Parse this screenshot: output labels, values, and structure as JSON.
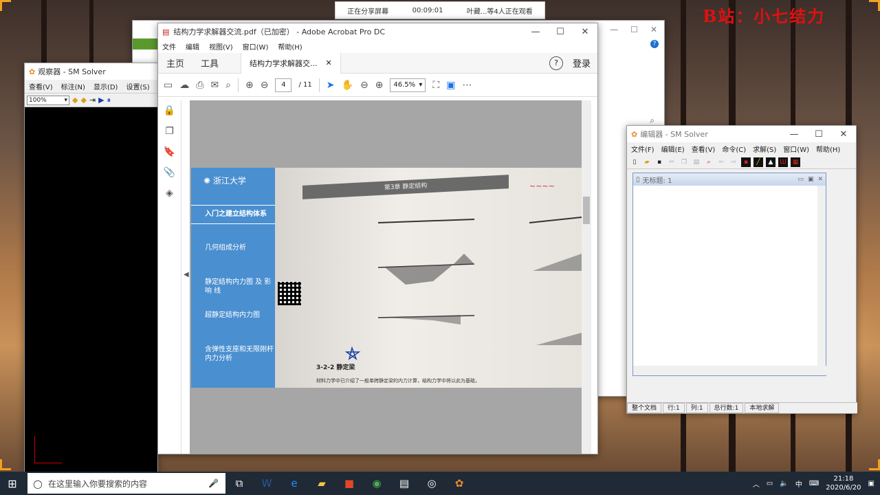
{
  "screen_share": {
    "status": "正在分享屏幕",
    "timer": "00:09:01",
    "viewers": "叶藏...等4人正在观看"
  },
  "watermark": "B站：小七结力",
  "viewer_window": {
    "title": "观察器 - SM Solver",
    "menu": [
      "查看(V)",
      "标注(N)",
      "显示(D)",
      "设置(S)"
    ],
    "zoom": "100%"
  },
  "acrobat": {
    "title": "结构力学求解器交流.pdf（已加密） - Adobe Acrobat Pro DC",
    "menu": [
      "文件",
      "编辑",
      "视图(V)",
      "窗口(W)",
      "帮助(H)"
    ],
    "nav_home": "主页",
    "nav_tools": "工具",
    "doc_tab": "结构力学求解器交...",
    "login": "登录",
    "page_current": "4",
    "page_total": "/ 11",
    "zoom": "46.5%",
    "slide": {
      "items": [
        "入门之建立结构体系",
        "几何组成分析",
        "静定结构内力图 及 影 响 线",
        "超静定结构内力图",
        "含弹性支座和无限刚杆内力分析"
      ],
      "book_heading": "第3章 静定结构",
      "section": "3-2-2 静定梁",
      "caption": "材料力学中已介绍了一般单跨静定梁的内力计算，结构力学中将以此为基础，"
    }
  },
  "editor_window": {
    "title": "编辑器 - SM Solver",
    "menu": [
      "文件(F)",
      "编辑(E)",
      "查看(V)",
      "命令(C)",
      "求解(S)",
      "窗口(W)",
      "帮助(H)"
    ],
    "doc_title": "无标题: 1",
    "status": [
      "整个文档",
      "行:1",
      "列:1",
      "总行数:1",
      "本地求解"
    ]
  },
  "taskbar": {
    "search_placeholder": "在这里输入你要搜索的内容",
    "time": "21:18",
    "date": "2020/6/20",
    "ime": "中"
  }
}
